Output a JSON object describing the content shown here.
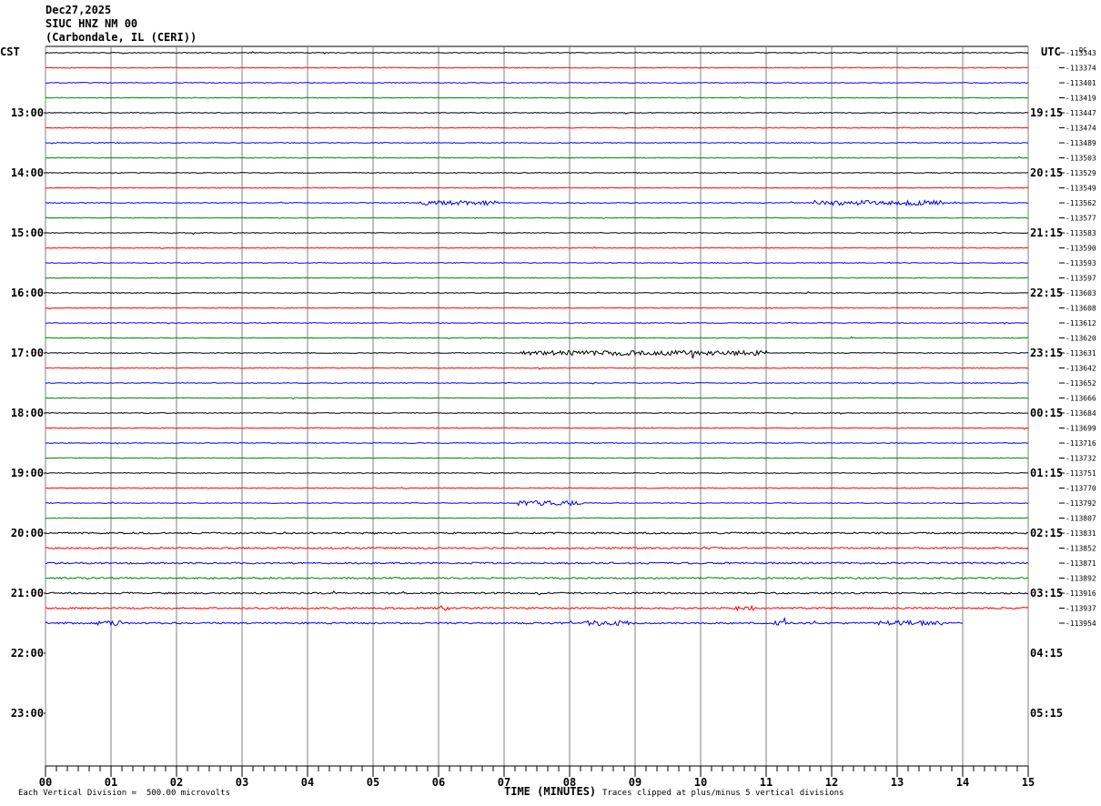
{
  "header": {
    "date": "Dec27,2025",
    "station": "SIUC HNZ NM 00",
    "location": "(Carbondale, IL (CERI))"
  },
  "left_tz": "CST",
  "right_tz": "UTC",
  "dc_label": "DC",
  "footer": {
    "scale_note": "Each Vertical Division =  500.00 microvolts",
    "x_title": "TIME (MINUTES)",
    "clip_note": "Traces clipped at plus/minus 5 vertical divisions"
  },
  "colors": {
    "trace_cycle": [
      "#000000",
      "#ff0000",
      "#0000ff",
      "#008000"
    ],
    "grid": "#808080"
  },
  "chart_data": {
    "type": "line",
    "title": "SIUC HNZ NM 00",
    "xlabel": "TIME (MINUTES)",
    "xlim": [
      0,
      15
    ],
    "x_ticks": [
      "00",
      "01",
      "02",
      "03",
      "04",
      "05",
      "06",
      "07",
      "08",
      "09",
      "10",
      "11",
      "12",
      "13",
      "14",
      "15"
    ],
    "rows_per_hour": 4,
    "hour_labels_left": [
      "13:00",
      "14:00",
      "15:00",
      "16:00",
      "17:00",
      "18:00",
      "19:00",
      "20:00",
      "21:00",
      "22:00",
      "23:00"
    ],
    "hour_labels_right": [
      "19:15",
      "20:15",
      "21:15",
      "22:15",
      "23:15",
      "00:15",
      "01:15",
      "02:15",
      "03:15",
      "04:15",
      "05:15"
    ],
    "trace_count": 39,
    "trace_dc_offsets": [
      "-113343",
      "-113374",
      "-113401",
      "-113419",
      "-113447",
      "-113474",
      "-113489",
      "-113503",
      "-113529",
      "-113549",
      "-113562",
      "-113577",
      "-113583",
      "-113590",
      "-113593",
      "-113597",
      "-113603",
      "-113608",
      "-113612",
      "-113620",
      "-113631",
      "-113642",
      "-113652",
      "-113666",
      "-113684",
      "-113699",
      "-113716",
      "-113732",
      "-113751",
      "-113770",
      "-113792",
      "-113807",
      "-113831",
      "-113852",
      "-113871",
      "-113892",
      "-113916",
      "-113937",
      "-113954"
    ],
    "last_trace_end_minute": 14.0,
    "notable_events": [
      {
        "trace": 10,
        "from_minute": 5.7,
        "to_minute": 6.9
      },
      {
        "trace": 10,
        "from_minute": 11.7,
        "to_minute": 13.7
      },
      {
        "trace": 20,
        "from_minute": 7.2,
        "to_minute": 11.0
      },
      {
        "trace": 30,
        "from_minute": 7.2,
        "to_minute": 8.2
      },
      {
        "trace": 37,
        "from_minute": 6.0,
        "to_minute": 6.2
      },
      {
        "trace": 37,
        "from_minute": 10.5,
        "to_minute": 10.8
      },
      {
        "trace": 38,
        "from_minute": 0.8,
        "to_minute": 1.2
      },
      {
        "trace": 38,
        "from_minute": 8.2,
        "to_minute": 8.9
      },
      {
        "trace": 38,
        "from_minute": 11.1,
        "to_minute": 11.3
      },
      {
        "trace": 38,
        "from_minute": 12.7,
        "to_minute": 13.7
      }
    ],
    "grid": true
  }
}
